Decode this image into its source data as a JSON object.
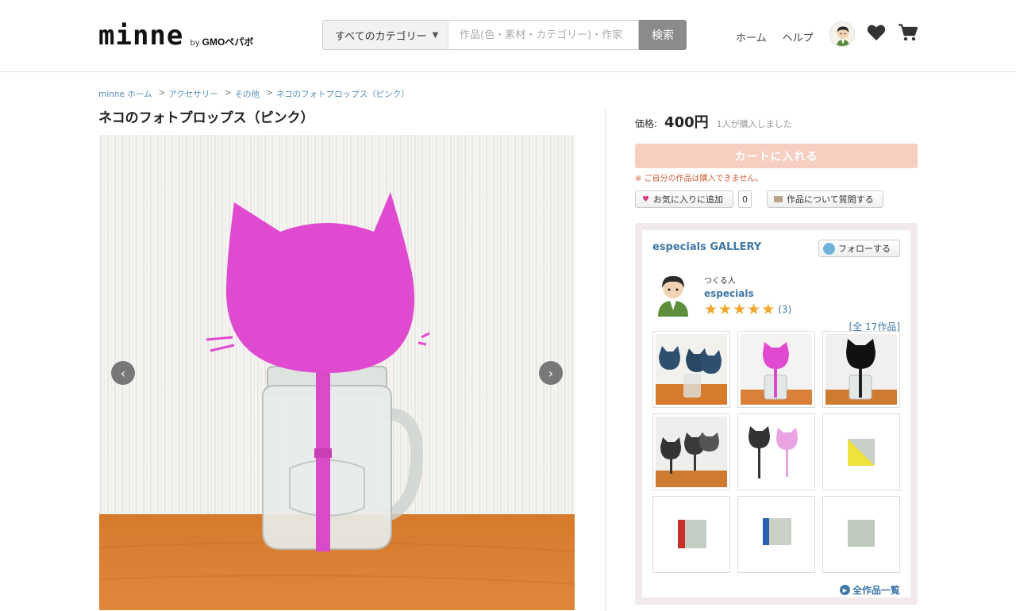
{
  "header": {
    "logo_main": "minne",
    "logo_by": "by",
    "logo_gmo": "GMOペパボ",
    "search": {
      "category": "すべてのカテゴリー",
      "placeholder": "作品(色・素材・カテゴリー)・作家",
      "button_label": "検索"
    },
    "nav": {
      "home": "ホーム",
      "help": "ヘルプ",
      "icons": [
        "avatar",
        "heart-icon",
        "cart-icon"
      ]
    }
  },
  "breadcrumb": [
    "minne ホーム",
    "アクセサリー",
    "その他",
    "ネコのフォトプロップス（ピンク）"
  ],
  "product": {
    "title": "ネコのフォトプロップス（ピンク）",
    "price_label": "価格:",
    "price": "400円",
    "purchased_text": "1人が購入しました",
    "cart_button": "カートに入れる",
    "notice": "※ ご自分の作品は購入できません。",
    "favorite_button": "お気に入りに追加",
    "favorite_count": "0",
    "ask_button": "作品について質問する"
  },
  "gallery": {
    "title": "especials GALLERY",
    "follow_button": "フォローする",
    "creator_label": "つくる人",
    "creator_name": "especials",
    "rating": 5,
    "rating_count": "(3)",
    "all_count": "[全 17作品]",
    "all_works_link": "全作品一覧"
  },
  "colors": {
    "link": "#3f78a6",
    "cart_button": "#f6cfc0",
    "notice": "#d2603c",
    "star": "#f1a62c",
    "gallery_bg": "#f1e9ea",
    "cat_pink": "#e04ad0"
  }
}
